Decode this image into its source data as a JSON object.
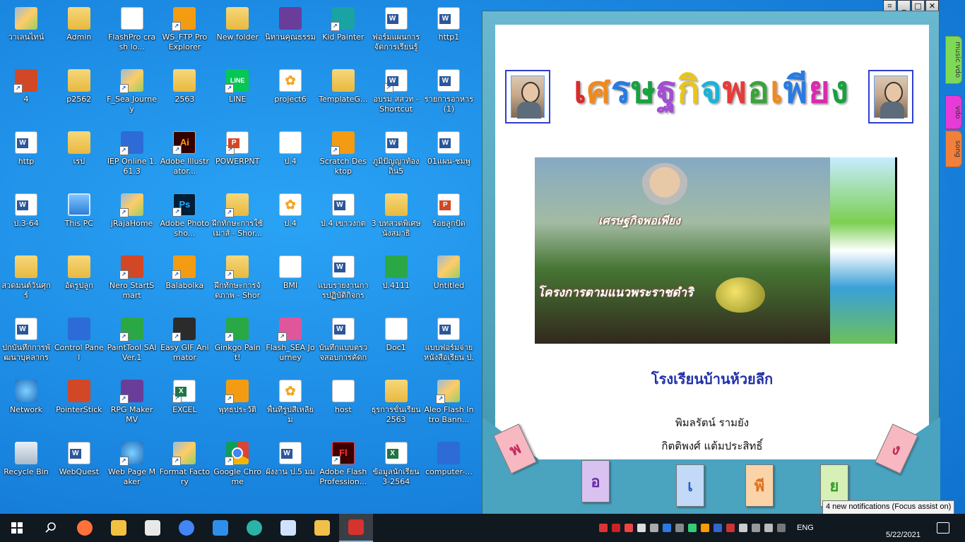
{
  "desktop": {
    "icons": [
      {
        "label": "วาเลนไทน์",
        "type": "photo",
        "shortcut": false
      },
      {
        "label": "Admin",
        "type": "folder",
        "shortcut": false
      },
      {
        "label": "FlashPro crash lo...",
        "type": "file",
        "shortcut": false
      },
      {
        "label": "WS_FTP Pro Explorer",
        "type": "orange",
        "shortcut": true
      },
      {
        "label": "New folder",
        "type": "folder",
        "shortcut": false
      },
      {
        "label": "นิทานคุณธรรม",
        "type": "purple",
        "shortcut": false
      },
      {
        "label": "Kid Painter",
        "type": "teal",
        "shortcut": true
      },
      {
        "label": "ฟอร์มแผนการจัดการเรียนรู้",
        "type": "word",
        "shortcut": false
      },
      {
        "label": "http1",
        "type": "word",
        "shortcut": false
      },
      {
        "label": "4",
        "type": "red",
        "shortcut": true
      },
      {
        "label": "p2562",
        "type": "folder",
        "shortcut": false
      },
      {
        "label": "F_Sea Journey",
        "type": "photo",
        "shortcut": true
      },
      {
        "label": "2563",
        "type": "folder",
        "shortcut": false
      },
      {
        "label": "LINE",
        "type": "line",
        "shortcut": true
      },
      {
        "label": "project6",
        "type": "scratch",
        "shortcut": false
      },
      {
        "label": "TemplateG...",
        "type": "folder",
        "shortcut": false
      },
      {
        "label": "อบรม สสวท - Shortcut",
        "type": "word",
        "shortcut": true
      },
      {
        "label": "รายการอาหาร(1)",
        "type": "word",
        "shortcut": false
      },
      {
        "label": "http",
        "type": "word",
        "shortcut": false
      },
      {
        "label": "เรป",
        "type": "folder",
        "shortcut": false
      },
      {
        "label": "IEP Online 1.61.3",
        "type": "blue",
        "shortcut": true
      },
      {
        "label": "Adobe Illustrator...",
        "type": "ai",
        "shortcut": true
      },
      {
        "label": "POWERPNT",
        "type": "ppt",
        "shortcut": true
      },
      {
        "label": "ป.4",
        "type": "file",
        "shortcut": false
      },
      {
        "label": "Scratch Desktop",
        "type": "orange",
        "shortcut": true
      },
      {
        "label": "ภูมิปัญญาท้องถิ่น5",
        "type": "word",
        "shortcut": false
      },
      {
        "label": "01แผน-ชมพู",
        "type": "word",
        "shortcut": false
      },
      {
        "label": "ป.3-64",
        "type": "word",
        "shortcut": false
      },
      {
        "label": "This PC",
        "type": "pc",
        "shortcut": false
      },
      {
        "label": "jRajaHome",
        "type": "photo",
        "shortcut": true
      },
      {
        "label": "Adobe Photosho...",
        "type": "ps",
        "shortcut": true
      },
      {
        "label": "ฝึกทักษะการใช้เมาส์ - Shor...",
        "type": "folder",
        "shortcut": true
      },
      {
        "label": "ป.4",
        "type": "scratch",
        "shortcut": false
      },
      {
        "label": "ป.4 เขาวงกต",
        "type": "word",
        "shortcut": false
      },
      {
        "label": "3 บทสวดพิเศษ นั่งสมาธิ",
        "type": "folder",
        "shortcut": false
      },
      {
        "label": "ร้อยลูกปัด",
        "type": "ppt",
        "shortcut": false
      },
      {
        "label": "สวดมนต์วันศุกร์",
        "type": "folder",
        "shortcut": false
      },
      {
        "label": "อัดรูปลูก",
        "type": "folder",
        "shortcut": false
      },
      {
        "label": "Nero StartSmart",
        "type": "red",
        "shortcut": true
      },
      {
        "label": "Balabolka",
        "type": "orange",
        "shortcut": true
      },
      {
        "label": "ฝึกทักษะการจัดภาพ - Short...",
        "type": "folder",
        "shortcut": true
      },
      {
        "label": "BMI",
        "type": "file",
        "shortcut": false
      },
      {
        "label": "แบบรายงานการปฏิบัติกิจกรร...",
        "type": "word",
        "shortcut": false
      },
      {
        "label": "ป.4111",
        "type": "green",
        "shortcut": false
      },
      {
        "label": "Untitled",
        "type": "photo",
        "shortcut": false
      },
      {
        "label": "ปกบันทึกการพัฒนาบุคลากร",
        "type": "word",
        "shortcut": false
      },
      {
        "label": "Control Panel",
        "type": "blue",
        "shortcut": false
      },
      {
        "label": "PaintTool SAI Ver.1",
        "type": "green",
        "shortcut": true
      },
      {
        "label": "Easy GIF Animator",
        "type": "dark",
        "shortcut": true
      },
      {
        "label": "Ginkgo Paint!",
        "type": "green",
        "shortcut": true
      },
      {
        "label": "Flash_SEA Journey",
        "type": "pink",
        "shortcut": true
      },
      {
        "label": "บันทึกแบบตรวจสอบการคัดกร...",
        "type": "word",
        "shortcut": false
      },
      {
        "label": "Doc1",
        "type": "file",
        "shortcut": false
      },
      {
        "label": "แบบฟอร์มจ่ายหนังสือเรียน ป.3",
        "type": "word",
        "shortcut": false
      },
      {
        "label": "Network",
        "type": "net",
        "shortcut": false
      },
      {
        "label": "PointerStick",
        "type": "red",
        "shortcut": false
      },
      {
        "label": "RPG Maker MV",
        "type": "purple",
        "shortcut": true
      },
      {
        "label": "EXCEL",
        "type": "xl",
        "shortcut": true
      },
      {
        "label": "พุทธประวัติ",
        "type": "orange",
        "shortcut": true
      },
      {
        "label": "พื้นที่รูปสี่เหลี่ยม",
        "type": "scratch",
        "shortcut": false
      },
      {
        "label": "host",
        "type": "file",
        "shortcut": false
      },
      {
        "label": "ธุรการขั้นเรียน 2563",
        "type": "folder",
        "shortcut": false
      },
      {
        "label": "Aleo Flash Intro Bann...",
        "type": "photo",
        "shortcut": true
      },
      {
        "label": "Recycle Bin",
        "type": "bin",
        "shortcut": false
      },
      {
        "label": "WebQuest",
        "type": "word",
        "shortcut": false
      },
      {
        "label": "Web Page Maker",
        "type": "net",
        "shortcut": true
      },
      {
        "label": "Format Factory",
        "type": "photo",
        "shortcut": true
      },
      {
        "label": "Google Chrome",
        "type": "chrome",
        "shortcut": true
      },
      {
        "label": "ผังงาน ป.5 มม",
        "type": "word",
        "shortcut": false
      },
      {
        "label": "Adobe Flash Profession...",
        "type": "fl",
        "shortcut": true
      },
      {
        "label": "ข้อมูลนักเรียน 3-2564",
        "type": "xl",
        "shortcut": false
      },
      {
        "label": "computer-...",
        "type": "blue",
        "shortcut": false
      }
    ]
  },
  "book": {
    "window_controls": [
      "⌗",
      "_",
      "□",
      "✕"
    ],
    "side_tabs": [
      {
        "label": "music vdo",
        "color": "#7ed957"
      },
      {
        "label": "vdo",
        "color": "#e63bd6"
      },
      {
        "label": "song",
        "color": "#f0803c"
      }
    ],
    "title_letters": [
      {
        "ch": "เ",
        "color": "#d92b2b"
      },
      {
        "ch": "ศ",
        "color": "#ef8a1e"
      },
      {
        "ch": "ร",
        "color": "#2a7be0"
      },
      {
        "ch": "ษ",
        "color": "#19a040"
      },
      {
        "ch": "ฐ",
        "color": "#a14fd0"
      },
      {
        "ch": "กิ",
        "color": "#e9c51b"
      },
      {
        "ch": "จ",
        "color": "#1ab3d8"
      },
      {
        "ch": "พ",
        "color": "#e63b3b"
      },
      {
        "ch": "อ",
        "color": "#3ba33b"
      },
      {
        "ch": "เ",
        "color": "#ef8a1e"
      },
      {
        "ch": "พี",
        "color": "#2a7be0"
      },
      {
        "ch": "ย",
        "color": "#d92bb0"
      },
      {
        "ch": "ง",
        "color": "#19a040"
      }
    ],
    "photo_title": "เศรษฐกิจพอเพียง",
    "photo_subtitle": "โครงการตามแนวพระราชดำริ",
    "school_name": "โรงเรียนบ้านห้วยลึก",
    "authors": [
      "พิมลรัตน์ รามยัง",
      "กิตติพงศ์ แต้มประสิทธิ์"
    ],
    "letter_cards": [
      {
        "ch": "พ",
        "bg": "#f7b8c2",
        "color": "#c42a5a"
      },
      {
        "ch": "อ",
        "bg": "#d9c2f0",
        "color": "#6a2aa8"
      },
      {
        "ch": "เ",
        "bg": "#c2d9f7",
        "color": "#2a5ac4"
      },
      {
        "ch": "พี",
        "bg": "#fbd3a8",
        "color": "#e0701a"
      },
      {
        "ch": "ย",
        "bg": "#d6f0b8",
        "color": "#3a9a2a"
      },
      {
        "ch": "ง",
        "bg": "#f7b8c2",
        "color": "#c42a5a"
      }
    ]
  },
  "notification": {
    "text": "4 new notifications (Focus assist on)"
  },
  "taskbar": {
    "apps": [
      {
        "name": "firefox-icon",
        "color": "#ff7139"
      },
      {
        "name": "file-explorer-icon",
        "color": "#f3c140"
      },
      {
        "name": "store-icon",
        "color": "#e8e8e8"
      },
      {
        "name": "chrome-icon",
        "color": "#4285f4"
      },
      {
        "name": "mail-icon",
        "color": "#2f8fe8"
      },
      {
        "name": "edge-icon",
        "color": "#2bb3a5"
      },
      {
        "name": "web-page-maker-icon",
        "color": "#cfe3ff"
      },
      {
        "name": "paint-icon",
        "color": "#f0c04a"
      },
      {
        "name": "flash-book-icon",
        "color": "#d6332e"
      }
    ],
    "language": "ENG",
    "date": "5/22/2021"
  }
}
